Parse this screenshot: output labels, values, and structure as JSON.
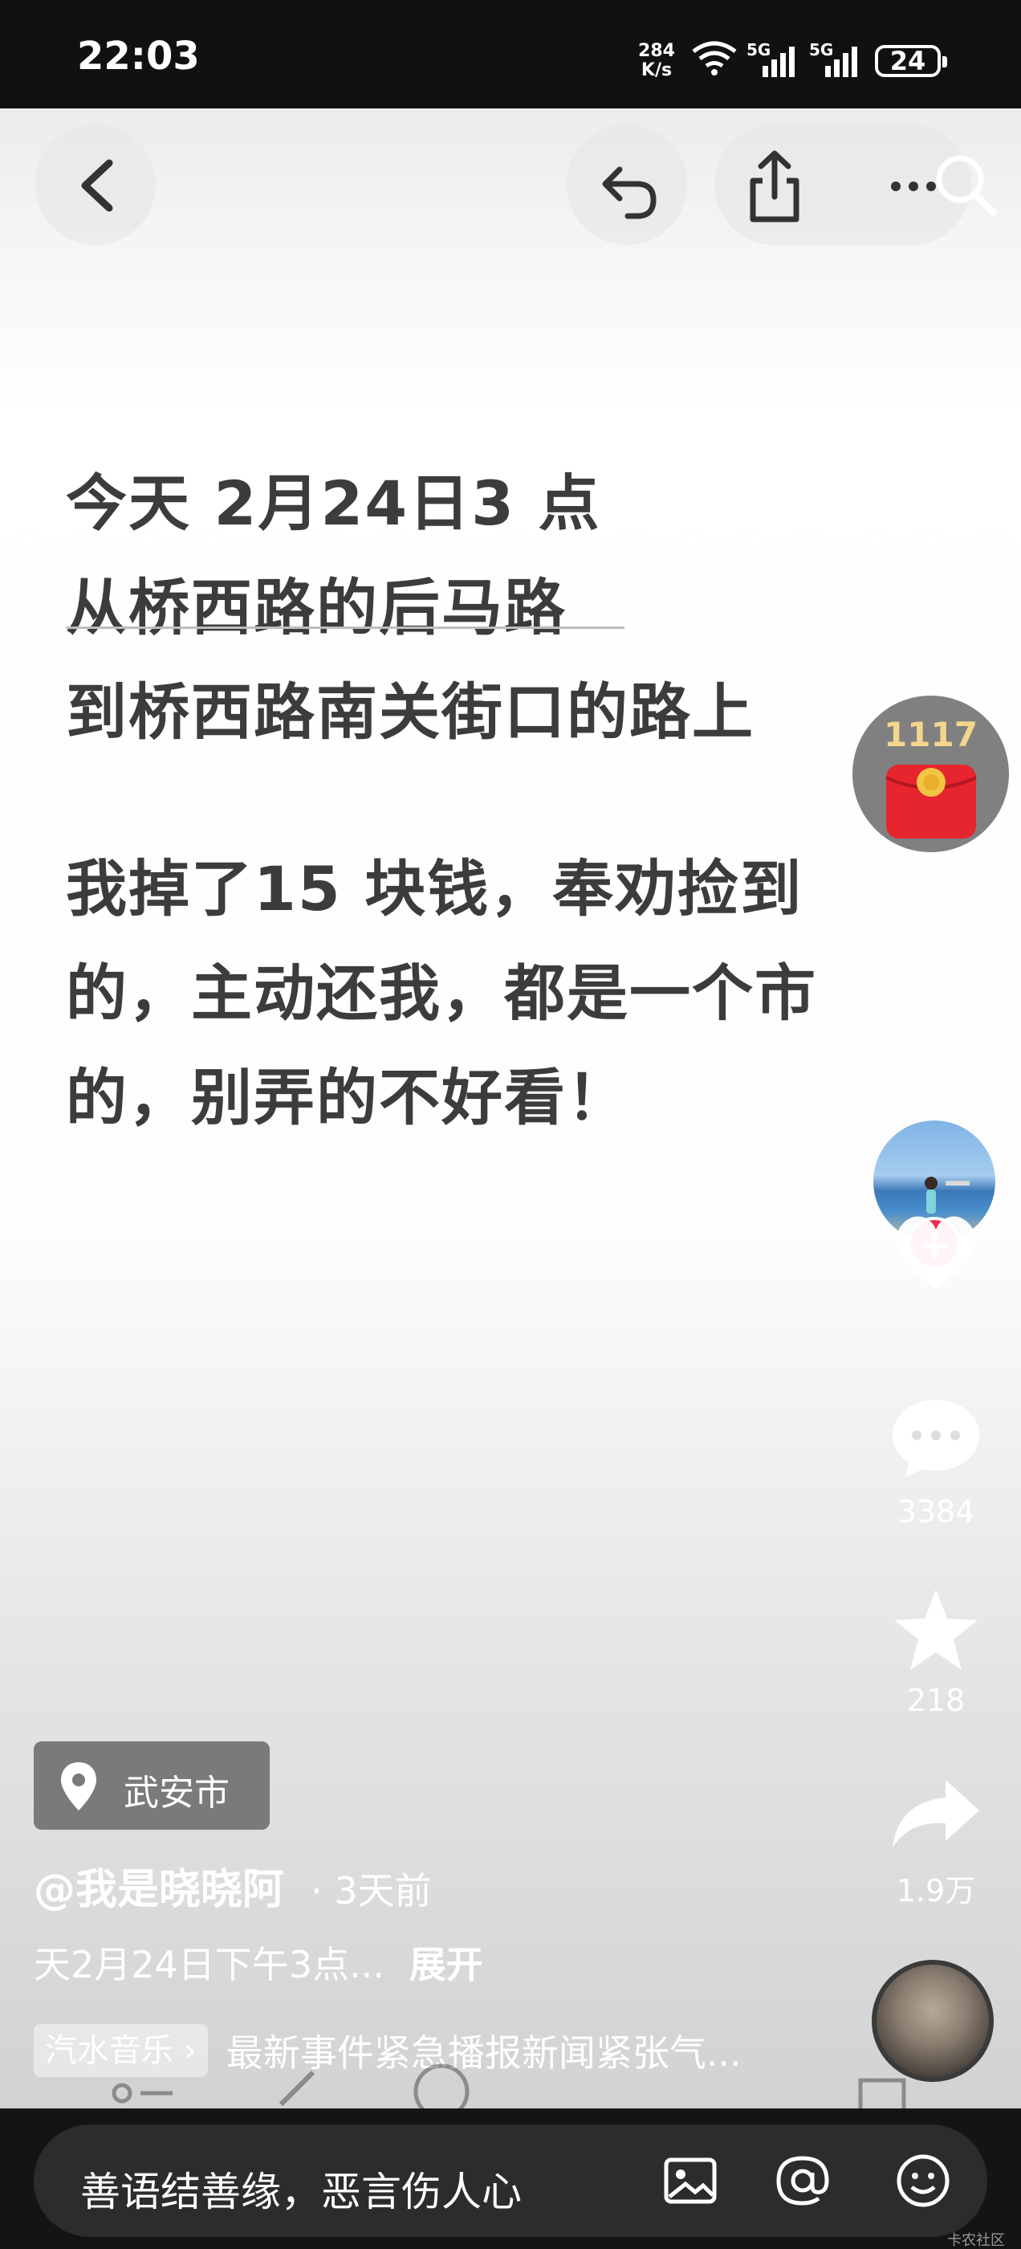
{
  "status_bar": {
    "time": "22:03",
    "net_speed_value": "284",
    "net_speed_unit": "K/s",
    "battery": "24",
    "signal_labels": [
      "5G",
      "5G"
    ]
  },
  "post": {
    "lines": [
      "今天 2月24日3 点",
      "从桥西路的后马路",
      "到桥西路南关街口的路上",
      "我掉了15 块钱，奉劝捡到",
      "的，主动还我，都是一个市",
      "的，别弄的不好看！"
    ]
  },
  "side_actions": {
    "red_packet_count": "1117",
    "comments_count": "3384",
    "favorites_count": "218",
    "shares_count": "1.9万"
  },
  "location": "武安市",
  "author": {
    "name": "@我是晓晓阿",
    "time_ago": "· 3天前"
  },
  "description": {
    "text": "天2月24日下午3点...",
    "expand_label": "展开"
  },
  "music": {
    "tag": "汽水音乐 ›",
    "title": "最新事件紧急播报新闻紧张气..."
  },
  "comment_bar": {
    "placeholder": "善语结善缘，恶言伤人心"
  },
  "watermark": "卡农社区",
  "colors": {
    "status_bar_bg": "#111111",
    "text_gray": "#3c3c3c",
    "follow_red": "#f0294f",
    "red_packet": "#e6252f",
    "bottom_bg": "#141414"
  },
  "icons": [
    "back-icon",
    "undo-icon",
    "share-upload-icon",
    "more-icon",
    "search-icon",
    "wifi-icon",
    "signal-icon",
    "heart-icon",
    "comment-icon",
    "star-icon",
    "share-arrow-icon",
    "location-pin-icon",
    "image-icon",
    "at-icon",
    "emoji-icon"
  ]
}
